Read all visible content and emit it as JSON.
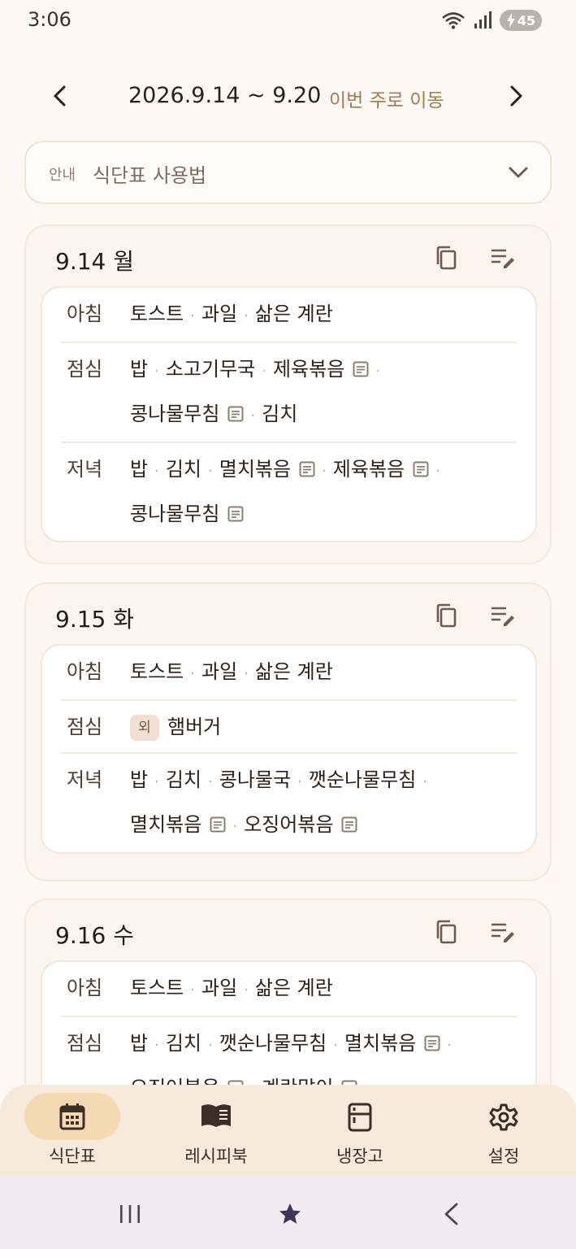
{
  "status_bar": {
    "time": "3:06",
    "battery": "45"
  },
  "week_nav": {
    "range": "2026.9.14 ~ 9.20",
    "this_week_label": "이번 주로 이동"
  },
  "guide": {
    "tag": "안내",
    "title": "식단표 사용법"
  },
  "days": [
    {
      "title": "9.14 월",
      "meals": [
        {
          "label": "아침",
          "lines": [
            [
              {
                "name": "토스트"
              },
              {
                "name": "과일"
              },
              {
                "name": "삶은 계란"
              }
            ]
          ]
        },
        {
          "label": "점심",
          "lines": [
            [
              {
                "name": "밥"
              },
              {
                "name": "소고기무국"
              },
              {
                "name": "제육볶음",
                "recipe": true
              }
            ],
            [
              {
                "name": "콩나물무침",
                "recipe": true
              },
              {
                "name": "김치"
              }
            ]
          ]
        },
        {
          "label": "저녁",
          "lines": [
            [
              {
                "name": "밥"
              },
              {
                "name": "김치"
              },
              {
                "name": "멸치볶음",
                "recipe": true
              },
              {
                "name": "제육볶음",
                "recipe": true
              }
            ],
            [
              {
                "name": "콩나물무침",
                "recipe": true
              }
            ]
          ]
        }
      ]
    },
    {
      "title": "9.15 화",
      "meals": [
        {
          "label": "아침",
          "lines": [
            [
              {
                "name": "토스트"
              },
              {
                "name": "과일"
              },
              {
                "name": "삶은 계란"
              }
            ]
          ]
        },
        {
          "label": "점심",
          "badge": "외",
          "lines": [
            [
              {
                "name": "햄버거"
              }
            ]
          ]
        },
        {
          "label": "저녁",
          "lines": [
            [
              {
                "name": "밥"
              },
              {
                "name": "김치"
              },
              {
                "name": "콩나물국"
              },
              {
                "name": "깻순나물무침"
              }
            ],
            [
              {
                "name": "멸치볶음",
                "recipe": true
              },
              {
                "name": "오징어볶음",
                "recipe": true
              }
            ]
          ]
        }
      ]
    },
    {
      "title": "9.16 수",
      "meals": [
        {
          "label": "아침",
          "lines": [
            [
              {
                "name": "토스트"
              },
              {
                "name": "과일"
              },
              {
                "name": "삶은 계란"
              }
            ]
          ]
        },
        {
          "label": "점심",
          "lines": [
            [
              {
                "name": "밥"
              },
              {
                "name": "김치"
              },
              {
                "name": "깻순나물무침"
              },
              {
                "name": "멸치볶음",
                "recipe": true
              }
            ],
            [
              {
                "name": "오징어볶음",
                "recipe": true
              },
              {
                "name": "계란말이",
                "recipe": true
              }
            ]
          ]
        }
      ]
    }
  ],
  "bottom_nav": [
    {
      "label": "식단표",
      "icon": "calendar-icon",
      "active": true
    },
    {
      "label": "레시피북",
      "icon": "book-icon"
    },
    {
      "label": "냉장고",
      "icon": "fridge-icon"
    },
    {
      "label": "설정",
      "icon": "gear-icon"
    }
  ],
  "colors": {
    "accent": "#a27b50",
    "active_pill": "#f5d9b5",
    "nav_bg": "#f7eadc",
    "page_bg": "#fdf8f4"
  }
}
